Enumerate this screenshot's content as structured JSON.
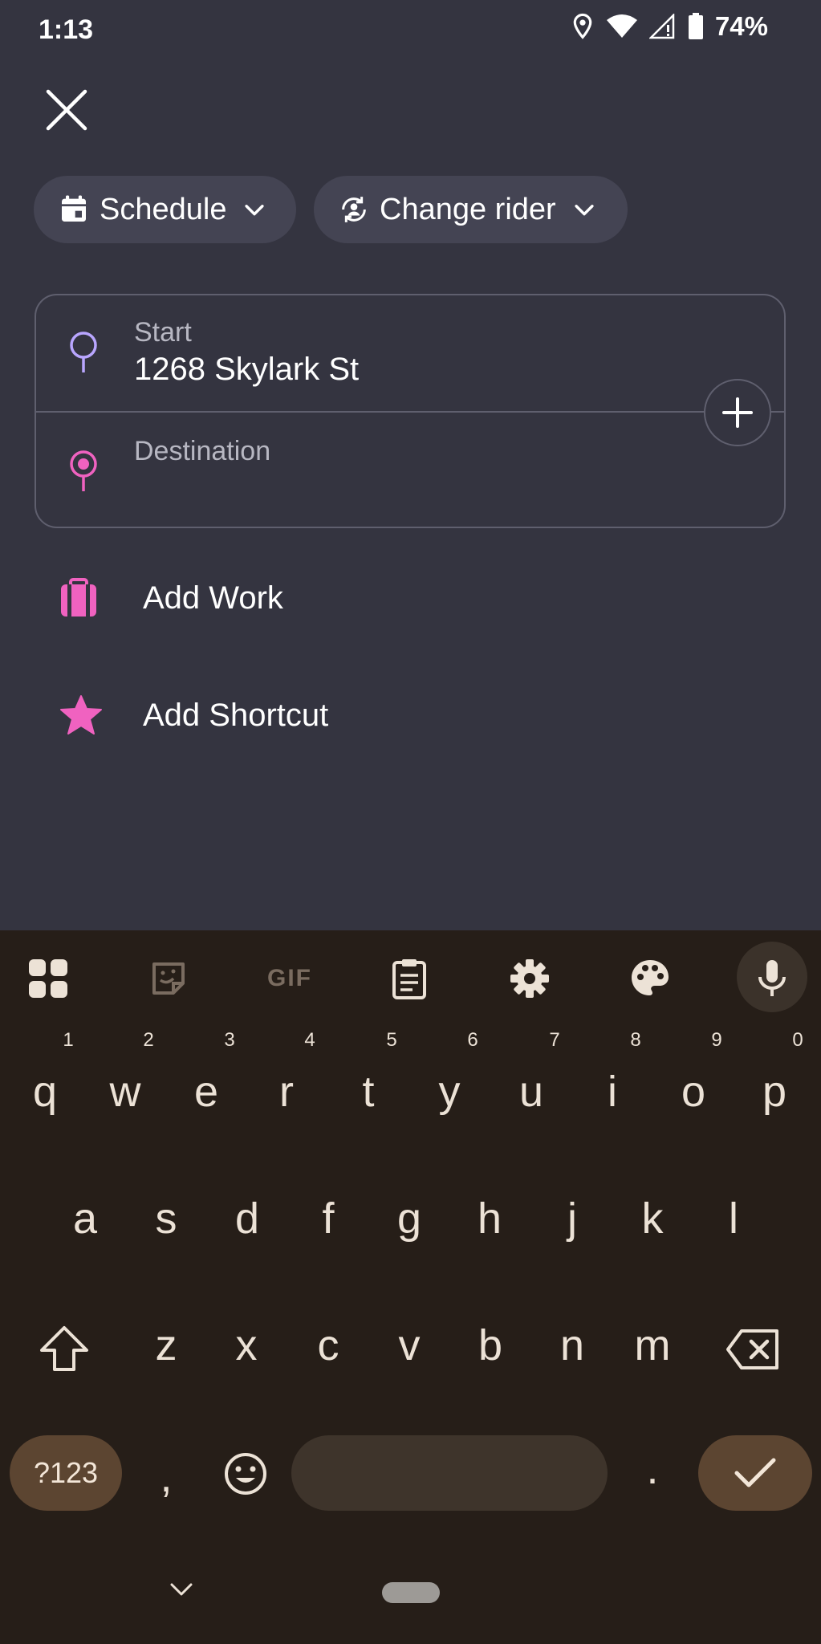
{
  "status_bar": {
    "time": "1:13",
    "battery": "74%"
  },
  "header": {
    "close_icon": "close-icon"
  },
  "chips": {
    "schedule": {
      "label": "Schedule",
      "icon": "calendar-icon"
    },
    "rider": {
      "label": "Change rider",
      "icon": "switch-account-icon"
    }
  },
  "route": {
    "start_label": "Start",
    "start_value": "1268 Skylark St",
    "destination_label": "Destination",
    "colors": {
      "start_pin": "#b9a6ff",
      "destination_pin": "#f062c0"
    }
  },
  "shortcuts": [
    {
      "label": "Add Work",
      "icon": "briefcase-icon",
      "color": "#f062c0"
    },
    {
      "label": "Add Shortcut",
      "icon": "star-icon",
      "color": "#f062c0"
    }
  ],
  "keyboard": {
    "row1": [
      "q",
      "w",
      "e",
      "r",
      "t",
      "y",
      "u",
      "i",
      "o",
      "p"
    ],
    "row1_hints": [
      "1",
      "2",
      "3",
      "4",
      "5",
      "6",
      "7",
      "8",
      "9",
      "0"
    ],
    "row2": [
      "a",
      "s",
      "d",
      "f",
      "g",
      "h",
      "j",
      "k",
      "l"
    ],
    "row3": [
      "z",
      "x",
      "c",
      "v",
      "b",
      "n",
      "m"
    ],
    "symbols": "?123",
    "comma": ",",
    "period": ".",
    "gif": "GIF"
  }
}
